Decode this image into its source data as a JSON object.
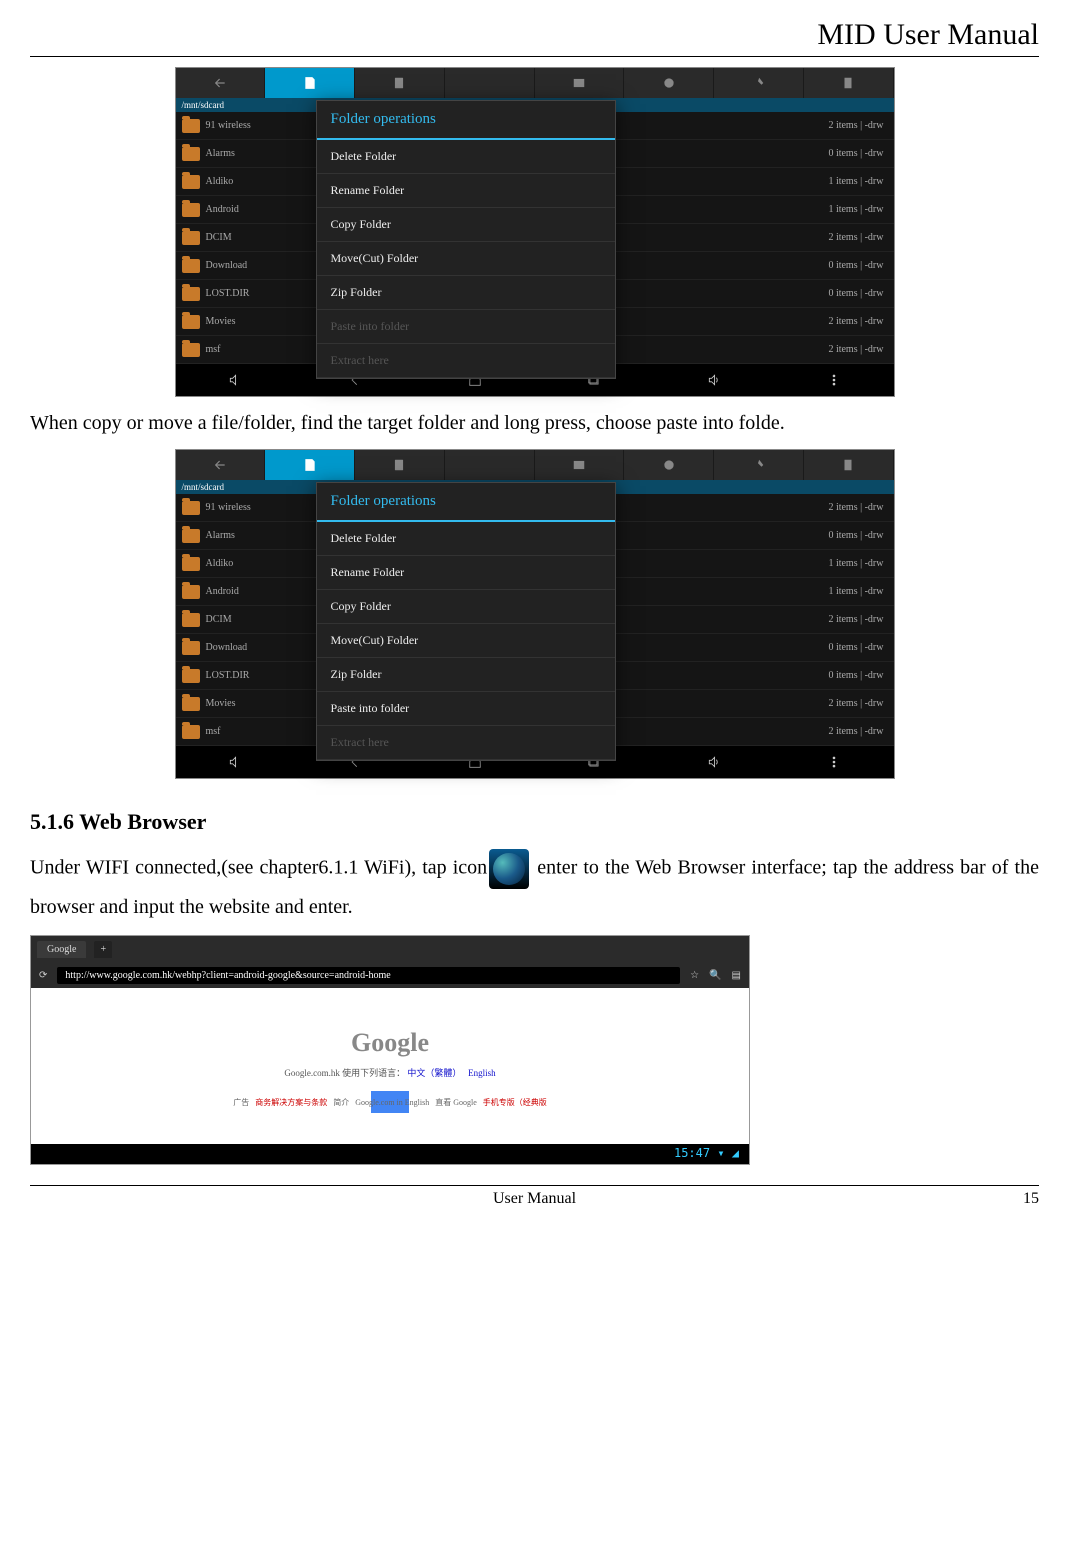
{
  "header": {
    "title": "MID User Manual"
  },
  "footer": {
    "center": "User Manual",
    "page": "15"
  },
  "screenshot1": {
    "path": "/mnt/sdcard",
    "dialog_title": "Folder operations",
    "dialog_items": [
      {
        "label": "Delete Folder",
        "disabled": false
      },
      {
        "label": "Rename Folder",
        "disabled": false
      },
      {
        "label": "Copy Folder",
        "disabled": false
      },
      {
        "label": "Move(Cut) Folder",
        "disabled": false
      },
      {
        "label": "Zip Folder",
        "disabled": false
      },
      {
        "label": "Paste into folder",
        "disabled": true
      },
      {
        "label": "Extract here",
        "disabled": true
      }
    ],
    "rows": [
      {
        "name": "91 wireless",
        "info": "2 items | -drw"
      },
      {
        "name": "Alarms",
        "info": "0 items | -drw"
      },
      {
        "name": "Aldiko",
        "info": "1 items | -drw"
      },
      {
        "name": "Android",
        "info": "1 items | -drw"
      },
      {
        "name": "DCIM",
        "info": "2 items | -drw"
      },
      {
        "name": "Download",
        "info": "0 items | -drw"
      },
      {
        "name": "LOST.DIR",
        "info": "0 items | -drw"
      },
      {
        "name": "Movies",
        "info": "2 items | -drw"
      },
      {
        "name": "msf",
        "info": "2 items | -drw"
      }
    ]
  },
  "caption1": "When copy or move a file/folder, find the target folder and long press, choose paste into folde.",
  "screenshot2": {
    "path": "/mnt/sdcard",
    "dialog_title": "Folder operations",
    "dialog_items": [
      {
        "label": "Delete Folder",
        "disabled": false
      },
      {
        "label": "Rename Folder",
        "disabled": false
      },
      {
        "label": "Copy Folder",
        "disabled": false
      },
      {
        "label": "Move(Cut) Folder",
        "disabled": false
      },
      {
        "label": "Zip Folder",
        "disabled": false
      },
      {
        "label": "Paste into folder",
        "disabled": false
      },
      {
        "label": "Extract here",
        "disabled": true
      }
    ],
    "rows": [
      {
        "name": "91 wireless",
        "info": "2 items | -drw"
      },
      {
        "name": "Alarms",
        "info": "0 items | -drw"
      },
      {
        "name": "Aldiko",
        "info": "1 items | -drw"
      },
      {
        "name": "Android",
        "info": "1 items | -drw"
      },
      {
        "name": "DCIM",
        "info": "2 items | -drw"
      },
      {
        "name": "Download",
        "info": "0 items | -drw"
      },
      {
        "name": "LOST.DIR",
        "info": "0 items | -drw"
      },
      {
        "name": "Movies",
        "info": "2 items | -drw"
      },
      {
        "name": "msf",
        "info": "2 items | -drw"
      }
    ]
  },
  "section": {
    "heading": "5.1.6 Web Browser",
    "para_before": "Under WIFI connected,(see chapter6.1.1 WiFi), tap icon",
    "para_after": " enter to the Web Browser interface; tap the address bar of the browser and input the website and enter."
  },
  "browser": {
    "tab_label": "Google",
    "tab_plus": "+",
    "url": "http://www.google.com.hk/webhp?client=android-google&source=android-home",
    "logo": "Google",
    "lang_line_prefix": "Google.com.hk 使用下列语言：",
    "lang1": "中文（繁體）",
    "lang2": "English",
    "footer_items": [
      "广告",
      "商务解决方案与条款",
      "简介",
      "Google.com in English",
      "直看 Google",
      "手机专版（经典版"
    ],
    "clock": "15:47"
  }
}
